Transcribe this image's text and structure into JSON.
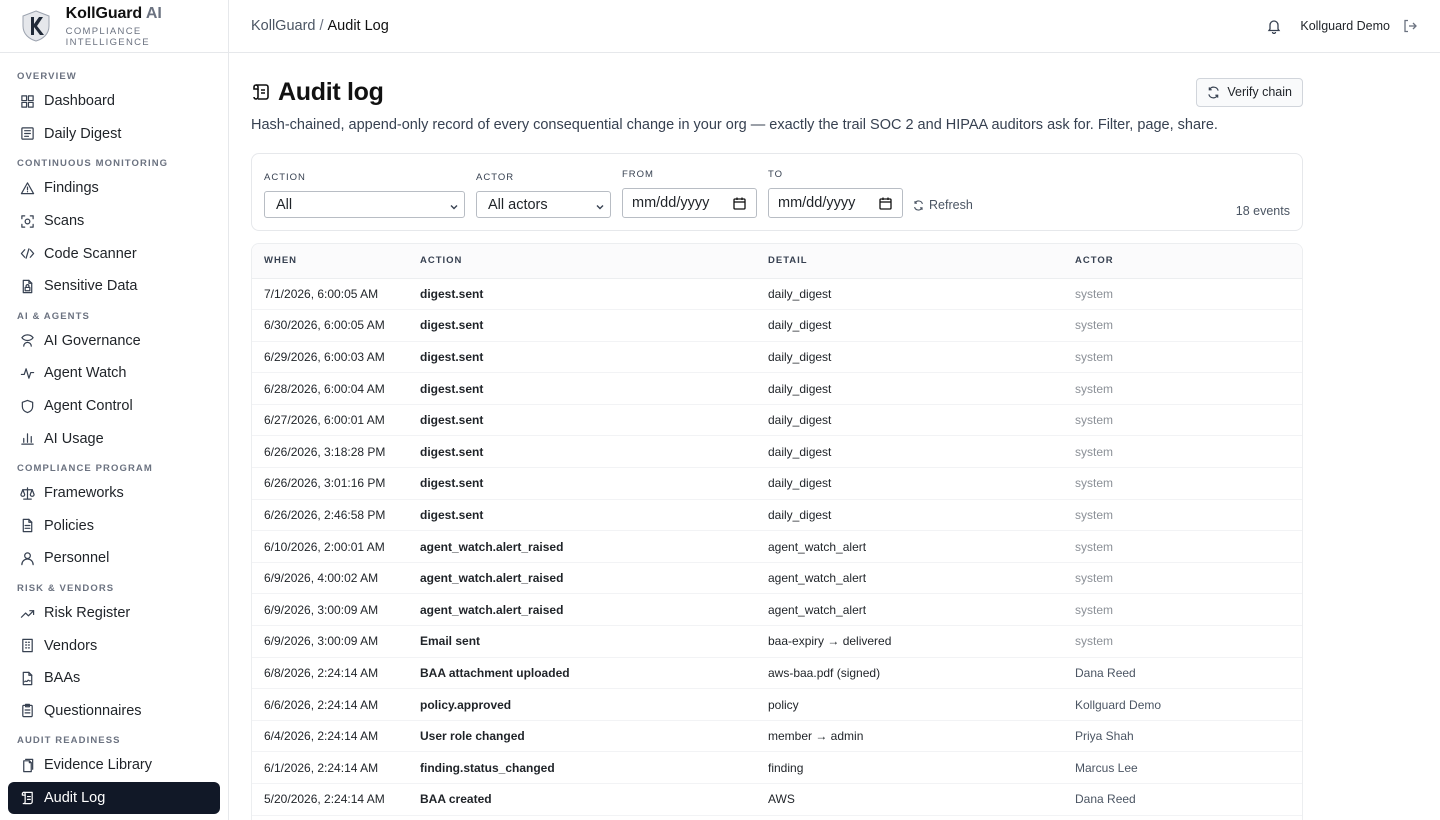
{
  "brand": {
    "name": "KollGuard",
    "name_suffix": "AI",
    "subtitle": "COMPLIANCE INTELLIGENCE"
  },
  "sidebar": {
    "sections": [
      {
        "title": "OVERVIEW",
        "items": [
          {
            "label": "Dashboard",
            "icon": "grid-icon"
          },
          {
            "label": "Daily Digest",
            "icon": "newspaper-icon"
          }
        ]
      },
      {
        "title": "CONTINUOUS MONITORING",
        "items": [
          {
            "label": "Findings",
            "icon": "warning-triangle-icon"
          },
          {
            "label": "Scans",
            "icon": "scan-icon"
          },
          {
            "label": "Code Scanner",
            "icon": "code-icon"
          },
          {
            "label": "Sensitive Data",
            "icon": "file-lock-icon"
          }
        ]
      },
      {
        "title": "AI & AGENTS",
        "items": [
          {
            "label": "AI Governance",
            "icon": "governance-icon"
          },
          {
            "label": "Agent Watch",
            "icon": "activity-icon"
          },
          {
            "label": "Agent Control",
            "icon": "shield-icon"
          },
          {
            "label": "AI Usage",
            "icon": "bar-chart-icon"
          }
        ]
      },
      {
        "title": "COMPLIANCE PROGRAM",
        "items": [
          {
            "label": "Frameworks",
            "icon": "scale-icon"
          },
          {
            "label": "Policies",
            "icon": "file-icon"
          },
          {
            "label": "Personnel",
            "icon": "user-icon"
          }
        ]
      },
      {
        "title": "RISK & VENDORS",
        "items": [
          {
            "label": "Risk Register",
            "icon": "trending-up-icon"
          },
          {
            "label": "Vendors",
            "icon": "building-icon"
          },
          {
            "label": "BAAs",
            "icon": "file-signature-icon"
          },
          {
            "label": "Questionnaires",
            "icon": "clipboard-icon"
          }
        ]
      },
      {
        "title": "AUDIT READINESS",
        "items": [
          {
            "label": "Evidence Library",
            "icon": "file-stack-icon"
          },
          {
            "label": "Audit Log",
            "icon": "scroll-icon",
            "active": true
          }
        ]
      }
    ]
  },
  "topbar": {
    "breadcrumb_root": "KollGuard",
    "breadcrumb_sep": "/",
    "breadcrumb_current": "Audit Log",
    "user_name": "Kollguard Demo"
  },
  "page": {
    "title": "Audit log",
    "subtitle": "Hash-chained, append-only record of every consequential change in your org — exactly the trail SOC 2 and HIPAA auditors ask for. Filter, page, share.",
    "verify_label": "Verify chain"
  },
  "filters": {
    "action_label": "ACTION",
    "action_value": "All",
    "actor_label": "ACTOR",
    "actor_value": "All actors",
    "from_label": "FROM",
    "from_placeholder": "mm/dd/yyyy",
    "to_label": "TO",
    "to_placeholder": "mm/dd/yyyy",
    "refresh_label": "Refresh",
    "event_count": "18 events"
  },
  "table": {
    "columns": [
      "WHEN",
      "ACTION",
      "DETAIL",
      "ACTOR"
    ],
    "rows": [
      {
        "when": "7/1/2026, 6:00:05 AM",
        "action": "digest.sent",
        "detail": "daily_digest",
        "actor": "system"
      },
      {
        "when": "6/30/2026, 6:00:05 AM",
        "action": "digest.sent",
        "detail": "daily_digest",
        "actor": "system"
      },
      {
        "when": "6/29/2026, 6:00:03 AM",
        "action": "digest.sent",
        "detail": "daily_digest",
        "actor": "system"
      },
      {
        "when": "6/28/2026, 6:00:04 AM",
        "action": "digest.sent",
        "detail": "daily_digest",
        "actor": "system"
      },
      {
        "when": "6/27/2026, 6:00:01 AM",
        "action": "digest.sent",
        "detail": "daily_digest",
        "actor": "system"
      },
      {
        "when": "6/26/2026, 3:18:28 PM",
        "action": "digest.sent",
        "detail": "daily_digest",
        "actor": "system"
      },
      {
        "when": "6/26/2026, 3:01:16 PM",
        "action": "digest.sent",
        "detail": "daily_digest",
        "actor": "system"
      },
      {
        "when": "6/26/2026, 2:46:58 PM",
        "action": "digest.sent",
        "detail": "daily_digest",
        "actor": "system"
      },
      {
        "when": "6/10/2026, 2:00:01 AM",
        "action": "agent_watch.alert_raised",
        "detail": "agent_watch_alert",
        "actor": "system"
      },
      {
        "when": "6/9/2026, 4:00:02 AM",
        "action": "agent_watch.alert_raised",
        "detail": "agent_watch_alert",
        "actor": "system"
      },
      {
        "when": "6/9/2026, 3:00:09 AM",
        "action": "agent_watch.alert_raised",
        "detail": "agent_watch_alert",
        "actor": "system"
      },
      {
        "when": "6/9/2026, 3:00:09 AM",
        "action": "Email sent",
        "detail": "baa-expiry → delivered",
        "actor": "system"
      },
      {
        "when": "6/8/2026, 2:24:14 AM",
        "action": "BAA attachment uploaded",
        "detail": "aws-baa.pdf (signed)",
        "actor": "Dana Reed"
      },
      {
        "when": "6/6/2026, 2:24:14 AM",
        "action": "policy.approved",
        "detail": "policy",
        "actor": "Kollguard Demo"
      },
      {
        "when": "6/4/2026, 2:24:14 AM",
        "action": "User role changed",
        "detail": "member → admin",
        "actor": "Priya Shah"
      },
      {
        "when": "6/1/2026, 2:24:14 AM",
        "action": "finding.status_changed",
        "detail": "finding",
        "actor": "Marcus Lee"
      },
      {
        "when": "5/20/2026, 2:24:14 AM",
        "action": "BAA created",
        "detail": "AWS",
        "actor": "Dana Reed"
      }
    ]
  }
}
